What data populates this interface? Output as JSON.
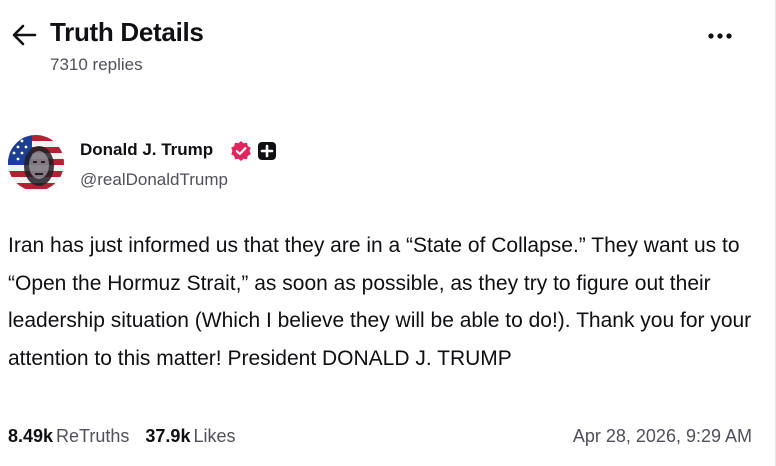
{
  "header": {
    "title": "Truth Details",
    "replies": "7310 replies",
    "back_icon": "arrow-left-icon",
    "more_icon": "more-horizontal-icon"
  },
  "author": {
    "display_name": "Donald J. Trump",
    "handle": "@realDonaldTrump",
    "verified_icon": "verified-badge-icon",
    "follow_icon": "plus-square-icon",
    "verified_color": "#e0245e"
  },
  "post": {
    "text": "Iran has just informed us that they are in a “State of Collapse.” They want us to “Open the Hormuz Strait,” as soon as possible, as they try to figure out their leadership situation (Which I believe they will be able to do!). Thank you for your attention to this matter! President DONALD J. TRUMP",
    "retruths_count": "8.49k",
    "retruths_label": "ReTruths",
    "likes_count": "37.9k",
    "likes_label": "Likes",
    "timestamp": "Apr 28, 2026, 9:29 AM"
  }
}
